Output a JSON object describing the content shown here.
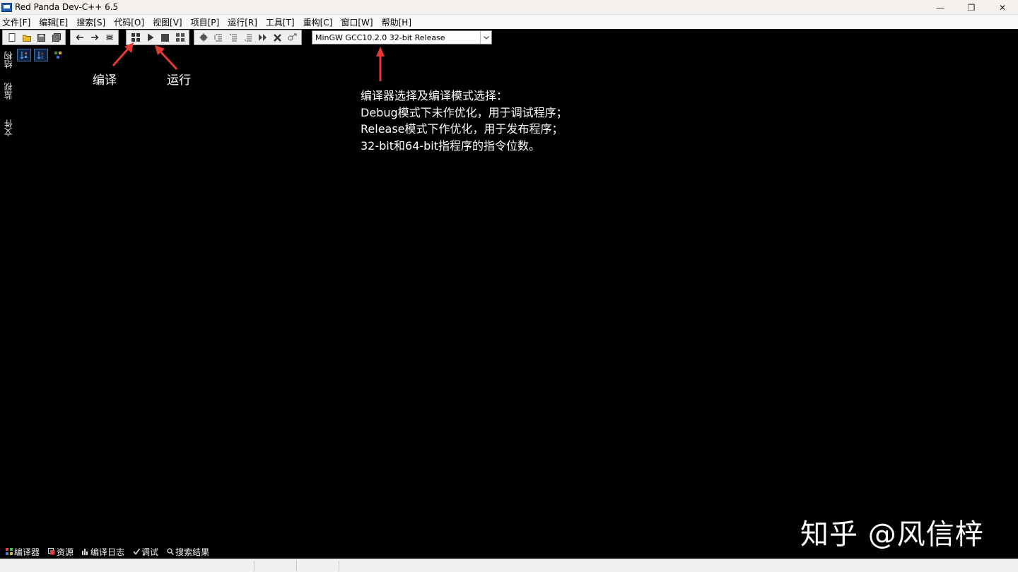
{
  "window": {
    "title": "Red Panda Dev-C++ 6.5",
    "minimize": "—",
    "restore": "❐",
    "close": "✕"
  },
  "menu": [
    "文件[F]",
    "编辑[E]",
    "搜索[S]",
    "代码[O]",
    "视图[V]",
    "项目[P]",
    "运行[R]",
    "工具[T]",
    "重构[C]",
    "窗口[W]",
    "帮助[H]"
  ],
  "toolbar": {
    "compiler_select": "MinGW GCC10.2.0 32-bit Release",
    "icons": {
      "file": [
        "new-file-icon",
        "open-file-icon",
        "save-icon",
        "save-all-icon"
      ],
      "nav": [
        "back-arrow-icon",
        "forward-arrow-icon",
        "goto-line-icon"
      ],
      "build": [
        "compile-icon",
        "run-icon",
        "stop-icon",
        "compile-run-icon"
      ],
      "debug": [
        "debug-icon",
        "step-over-icon",
        "step-into-icon",
        "step-out-icon",
        "continue-icon",
        "stop-debug-icon",
        "evaluate-icon"
      ]
    }
  },
  "left_dock": {
    "tabs": [
      "结构",
      "监视",
      "文件"
    ]
  },
  "annotations": {
    "compile": "编译",
    "run": "运行",
    "compiler_lines": [
      "编译器选择及编译模式选择：",
      "Debug模式下未作优化，用于调试程序；",
      "Release模式下作优化，用于发布程序；",
      "32-bit和64-bit指程序的指令位数。"
    ],
    "arrow_color": "#e53935"
  },
  "watermark": "知乎 @风信梓",
  "bottom_tabs": [
    "编译器",
    "资源",
    "编译日志",
    "调试",
    "搜索结果"
  ]
}
